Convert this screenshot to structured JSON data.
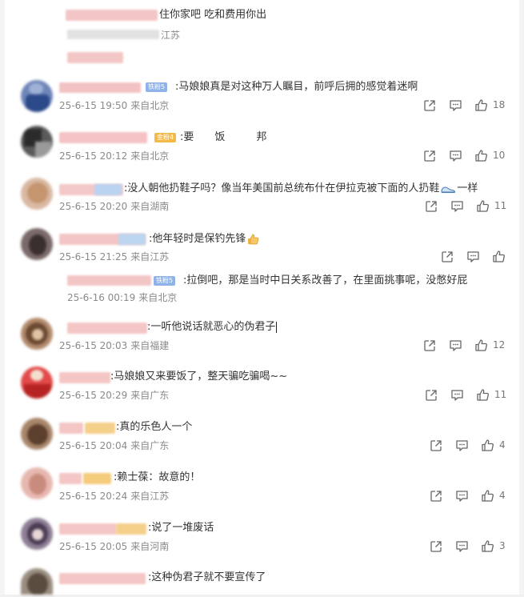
{
  "comments": [
    {
      "text": "住你家吧 吃和费用你出",
      "location": "江苏"
    },
    {
      "badge": "铁粉5",
      "text": ":马娘娘真是对这种万人瞩目，前呼后拥的感觉着迷啊",
      "time": "25-6-15 19:50",
      "location": "来自北京",
      "likes": "18"
    },
    {
      "badge": "金粉4",
      "text": ":要　　饭　　　邦",
      "time": "25-6-15 20:12",
      "location": "来自北京",
      "likes": "10"
    },
    {
      "text": ":没人朝他扔鞋子吗？像当年美国前总统布什在伊拉克被下面的人扔鞋",
      "suffix": "一样",
      "time": "25-6-15 20:20",
      "location": "来自湖南",
      "likes": "11"
    },
    {
      "text": ":他年轻时是保钓先锋",
      "time": "25-6-15 21:25",
      "location": "来自江苏",
      "likes": ""
    },
    {
      "badge": "铁粉5",
      "text": ":拉倒吧，那是当时中日关系改善了，在里面挑事呢，没憋好屁",
      "time": "25-6-16 00:19",
      "location": "来自北京"
    },
    {
      "text": ":一听他说话就恶心的伪君子",
      "time": "25-6-15 20:03",
      "location": "来自福建",
      "likes": "12"
    },
    {
      "text": ":马娘娘又来要饭了，整天骗吃骗喝~~",
      "time": "25-6-15 20:29",
      "location": "来自广东",
      "likes": "11"
    },
    {
      "text": ":真的乐色人一个",
      "time": "25-6-15 20:04",
      "location": "来自广东",
      "likes": "4"
    },
    {
      "text": ":赖士葆：故意的！",
      "time": "25-6-15 20:24",
      "location": "来自江苏",
      "likes": "4"
    },
    {
      "text": ":说了一堆废话",
      "time": "25-6-15 20:05",
      "location": "来自河南",
      "likes": "3"
    },
    {
      "text": ":这种伪君子就不要宣传了"
    }
  ],
  "icons": {
    "share": "share-icon",
    "comment": "comment-icon",
    "like": "thumbs-up-icon",
    "shoe": "sneaker-emoji",
    "thumb": "thumbs-up-emoji"
  },
  "colors": {
    "meta": "#8a8a8a",
    "icon": "#666666",
    "badge_blue": "#8fb3e8",
    "badge_gold": "#f5b94a"
  }
}
